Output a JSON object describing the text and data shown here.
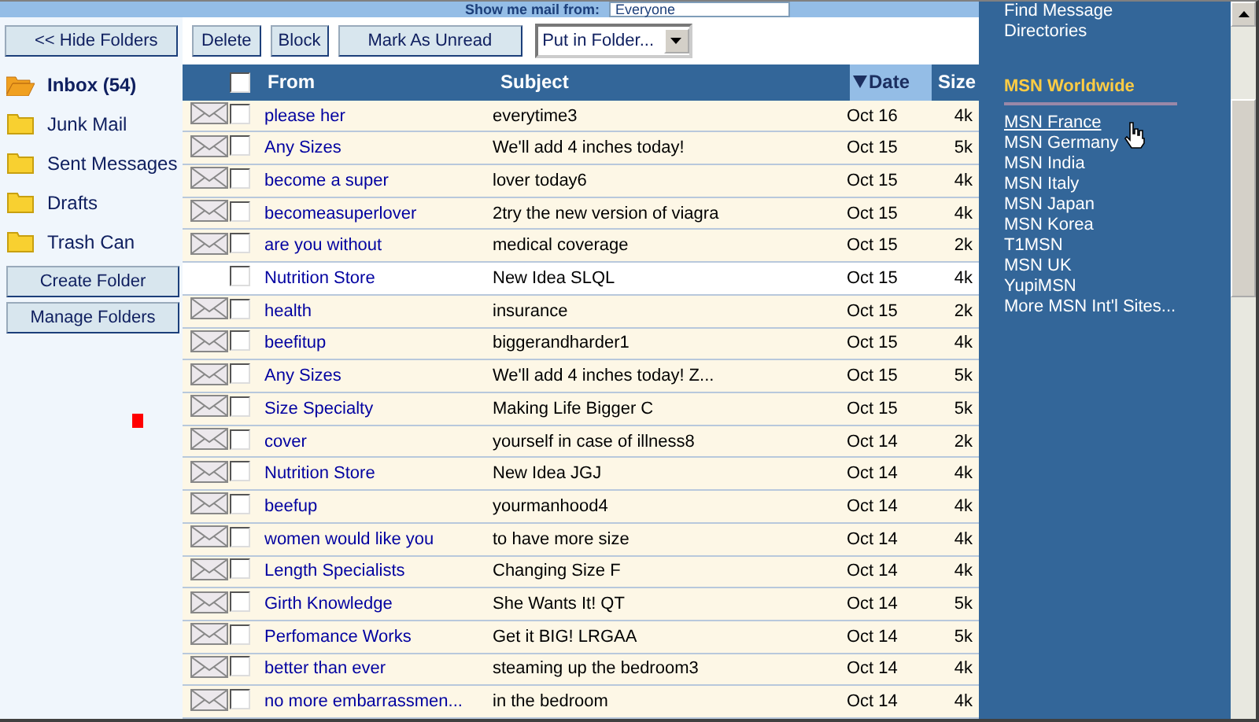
{
  "filter": {
    "label": "Show me mail from:",
    "value": "Everyone"
  },
  "toolbar": {
    "hide_folders": "<< Hide Folders",
    "buttons": [
      "Delete",
      "Block",
      "Mark As Unread"
    ],
    "move_select": "Put in Folder..."
  },
  "folders": [
    {
      "name": "Inbox (54)",
      "selected": true
    },
    {
      "name": "Junk Mail",
      "selected": false
    },
    {
      "name": "Sent Messages",
      "selected": false
    },
    {
      "name": "Drafts",
      "selected": false
    },
    {
      "name": "Trash Can",
      "selected": false
    }
  ],
  "folder_buttons": [
    "Create Folder",
    "Manage Folders"
  ],
  "table": {
    "select_all_checked": false,
    "columns": [
      {
        "label": "From",
        "sorted": false
      },
      {
        "label": "Subject",
        "sorted": false
      },
      {
        "label": "Date",
        "sorted": true
      },
      {
        "label": "Size",
        "sorted": false
      }
    ],
    "rows": [
      {
        "from": "please her",
        "subject": "everytime3",
        "date": "Oct 16",
        "size": "4k",
        "read": false,
        "checked": false
      },
      {
        "from": "Any Sizes",
        "subject": "We'll add 4 inches today!",
        "date": "Oct 15",
        "size": "5k",
        "read": false,
        "checked": false
      },
      {
        "from": "become a super",
        "subject": "lover today6",
        "date": "Oct 15",
        "size": "4k",
        "read": false,
        "checked": false
      },
      {
        "from": "becomeasuperlover",
        "subject": "2try the new version of viagra",
        "date": "Oct 15",
        "size": "4k",
        "read": false,
        "checked": false
      },
      {
        "from": "are you without",
        "subject": "medical coverage",
        "date": "Oct 15",
        "size": "2k",
        "read": false,
        "checked": false
      },
      {
        "from": "Nutrition Store",
        "subject": "New Idea SLQL",
        "date": "Oct 15",
        "size": "4k",
        "read": true,
        "checked": false
      },
      {
        "from": "health",
        "subject": "insurance",
        "date": "Oct 15",
        "size": "2k",
        "read": false,
        "checked": false
      },
      {
        "from": "beefitup",
        "subject": "biggerandharder1",
        "date": "Oct 15",
        "size": "4k",
        "read": false,
        "checked": false
      },
      {
        "from": "Any Sizes",
        "subject": "We'll add 4 inches today! Z...",
        "date": "Oct 15",
        "size": "5k",
        "read": false,
        "checked": false
      },
      {
        "from": "Size Specialty",
        "subject": "Making Life Bigger C",
        "date": "Oct 15",
        "size": "5k",
        "read": false,
        "checked": false
      },
      {
        "from": "cover",
        "subject": "yourself in case of illness8",
        "date": "Oct 14",
        "size": "2k",
        "read": false,
        "checked": false
      },
      {
        "from": "Nutrition Store",
        "subject": "New Idea JGJ",
        "date": "Oct 14",
        "size": "4k",
        "read": false,
        "checked": false
      },
      {
        "from": "beefup",
        "subject": "yourmanhood4",
        "date": "Oct 14",
        "size": "4k",
        "read": false,
        "checked": false
      },
      {
        "from": "women would like you",
        "subject": "to have more size",
        "date": "Oct 14",
        "size": "4k",
        "read": false,
        "checked": false
      },
      {
        "from": "Length Specialists",
        "subject": "Changing Size F",
        "date": "Oct 14",
        "size": "4k",
        "read": false,
        "checked": false
      },
      {
        "from": "Girth Knowledge",
        "subject": "She Wants It! QT",
        "date": "Oct 14",
        "size": "5k",
        "read": false,
        "checked": false
      },
      {
        "from": "Perfomance Works",
        "subject": "Get it BIG! LRGAA",
        "date": "Oct 14",
        "size": "5k",
        "read": false,
        "checked": false
      },
      {
        "from": "better than ever",
        "subject": "steaming up the bedroom3",
        "date": "Oct 14",
        "size": "4k",
        "read": false,
        "checked": false
      },
      {
        "from": "no more embarrassmen...",
        "subject": "in the bedroom",
        "date": "Oct 14",
        "size": "4k",
        "read": false,
        "checked": false
      }
    ]
  },
  "right_panel": {
    "links": [
      "Find Message",
      "Directories"
    ],
    "heading": "MSN Worldwide",
    "sites": [
      {
        "label": "MSN France",
        "hovered": true
      },
      {
        "label": "MSN Germany",
        "hovered": false
      },
      {
        "label": "MSN India",
        "hovered": false
      },
      {
        "label": "MSN Italy",
        "hovered": false
      },
      {
        "label": "MSN Japan",
        "hovered": false
      },
      {
        "label": "MSN Korea",
        "hovered": false
      },
      {
        "label": "T1MSN",
        "hovered": false
      },
      {
        "label": "MSN UK",
        "hovered": false
      },
      {
        "label": "YupiMSN",
        "hovered": false
      },
      {
        "label": "More MSN Int'l Sites...",
        "hovered": false
      }
    ]
  }
}
